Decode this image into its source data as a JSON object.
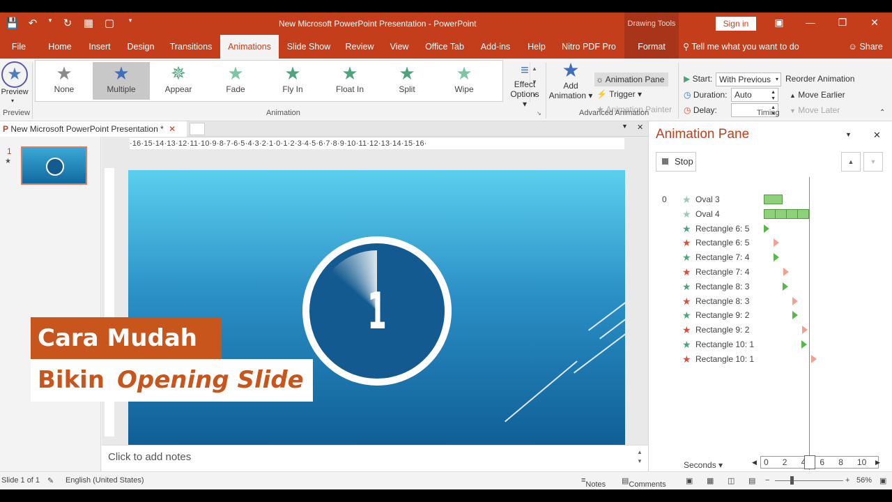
{
  "window": {
    "title": "New Microsoft PowerPoint Presentation - PowerPoint",
    "drawing_tools": "Drawing Tools",
    "sign_in": "Sign in"
  },
  "tabs": {
    "file": "File",
    "home": "Home",
    "insert": "Insert",
    "design": "Design",
    "transitions": "Transitions",
    "animations": "Animations",
    "slide_show": "Slide Show",
    "review": "Review",
    "view": "View",
    "office_tab": "Office Tab",
    "add_ins": "Add-ins",
    "help": "Help",
    "nitro": "Nitro PDF Pro",
    "format": "Format",
    "tell_me": "Tell me what you want to do",
    "share": "Share"
  },
  "ribbon": {
    "preview_label": "Preview",
    "preview_group": "Preview",
    "animation_group": "Animation",
    "advanced_group": "Advanced Animation",
    "timing_group": "Timing",
    "gallery": [
      {
        "label": "None",
        "color": "#8a8a8a"
      },
      {
        "label": "Multiple",
        "color": "#3f6fba"
      },
      {
        "label": "Appear",
        "color": "#4da37c"
      },
      {
        "label": "Fade",
        "color": "#7cc6a4"
      },
      {
        "label": "Fly In",
        "color": "#4da37c"
      },
      {
        "label": "Float In",
        "color": "#4da37c"
      },
      {
        "label": "Split",
        "color": "#4da37c"
      },
      {
        "label": "Wipe",
        "color": "#7cc6a4"
      }
    ],
    "effect_options_1": "Effect",
    "effect_options_2": "Options",
    "add_animation_1": "Add",
    "add_animation_2": "Animation",
    "animation_pane": "Animation Pane",
    "trigger": "Trigger",
    "animation_painter": "Animation Painter",
    "start_label": "Start:",
    "start_value": "With Previous",
    "duration_label": "Duration:",
    "duration_value": "Auto",
    "delay_label": "Delay:",
    "delay_value": "",
    "reorder": "Reorder Animation",
    "move_earlier": "Move Earlier",
    "move_later": "Move Later"
  },
  "document": {
    "tab_title": "New Microsoft PowerPoint Presentation *",
    "ruler": "·16·15·14·13·12·11·10·9·8·7·6·5·4·3·2·1·0·1·2·3·4·5·6·7·8·9·10·11·12·13·14·15·16·",
    "slide_number": "1",
    "slide_digit": "1",
    "notes_placeholder": "Click to add notes"
  },
  "caption": {
    "line1": "Cara Mudah",
    "line2_plain": "Bikin",
    "line2_italic": "Opening Slide"
  },
  "animation_pane": {
    "title": "Animation Pane",
    "stop": "Stop",
    "step_index": "0",
    "items": [
      {
        "name": "Oval 3",
        "effect": "entrance-faded"
      },
      {
        "name": "Oval 4",
        "effect": "entrance-faded"
      },
      {
        "name": "Rectangle 6: 5",
        "effect": "entrance"
      },
      {
        "name": "Rectangle 6: 5",
        "effect": "exit"
      },
      {
        "name": "Rectangle 7: 4",
        "effect": "entrance"
      },
      {
        "name": "Rectangle 7: 4",
        "effect": "exit"
      },
      {
        "name": "Rectangle 8: 3",
        "effect": "entrance"
      },
      {
        "name": "Rectangle 8: 3",
        "effect": "exit"
      },
      {
        "name": "Rectangle 9: 2",
        "effect": "entrance"
      },
      {
        "name": "Rectangle 9: 2",
        "effect": "exit"
      },
      {
        "name": "Rectangle 10: 1",
        "effect": "entrance"
      },
      {
        "name": "Rectangle 10: 1",
        "effect": "exit"
      }
    ],
    "seconds": "Seconds",
    "timeline_ticks": [
      "0",
      "2",
      "4",
      "6",
      "8",
      "10"
    ]
  },
  "status": {
    "slide_info": "Slide 1 of 1",
    "language": "English (United States)",
    "notes": "Notes",
    "comments": "Comments",
    "zoom": "56%"
  },
  "colors": {
    "accent": "#c43e1c",
    "entrance": "#4da37c",
    "exit": "#d9503a",
    "caption_orange": "#c8561c"
  }
}
